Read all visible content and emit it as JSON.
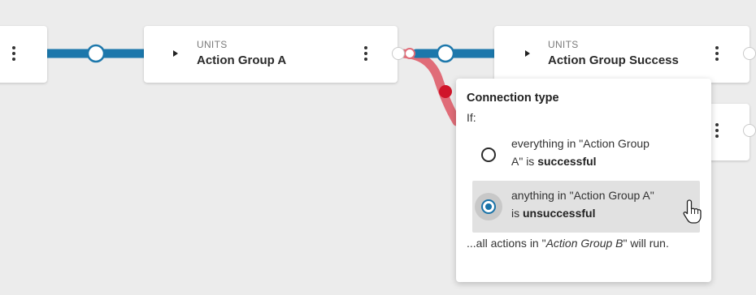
{
  "colors": {
    "canvas_bg": "#ececec",
    "success_link": "#1c77ab",
    "failure_link": "#e06c78",
    "failure_dot": "#d0152a",
    "radio_selected": "#1a73a8",
    "option_selected_bg": "#e1e1e1"
  },
  "nodes": [
    {
      "caption": "",
      "title": "",
      "menu_icon": "kebab-icon"
    },
    {
      "caption": "UNITS",
      "title": "Action Group A",
      "expand_icon": "caret-right-icon",
      "menu_icon": "kebab-icon"
    },
    {
      "caption": "UNITS",
      "title": "Action Group Success",
      "expand_icon": "caret-right-icon",
      "menu_icon": "kebab-icon"
    },
    {
      "caption": "",
      "title": "",
      "menu_icon": "kebab-icon"
    }
  ],
  "popup": {
    "title": "Connection type",
    "if_label": "If:",
    "options": [
      {
        "line1": "everything in \"Action Group",
        "line2_prefix": "A\" is ",
        "line2_bold": "successful",
        "selected": false
      },
      {
        "line1": "anything in \"Action Group A\"",
        "line2_prefix": "is ",
        "line2_bold": "unsuccessful",
        "selected": true
      }
    ],
    "footer_prefix": "...all actions in \"",
    "footer_italic": "Action Group B",
    "footer_suffix": "\" will run."
  },
  "cursor_icon": "hand-pointer-icon"
}
